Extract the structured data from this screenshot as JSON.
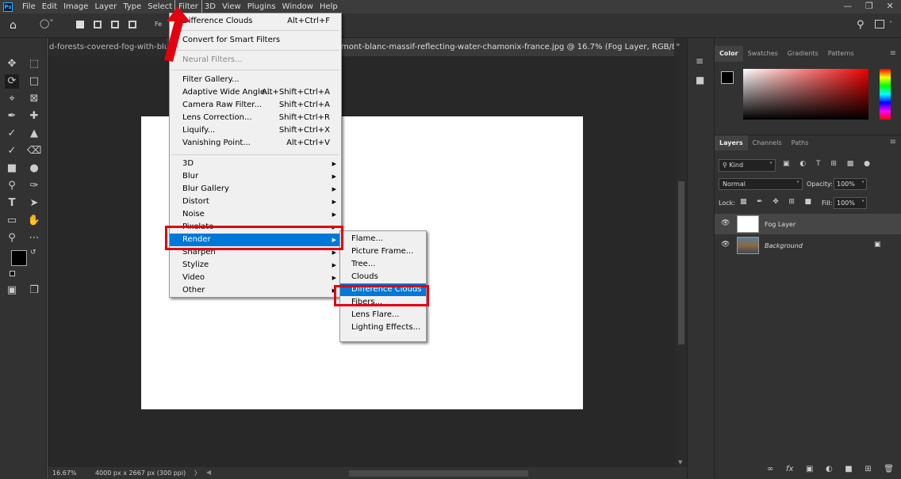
{
  "app": {
    "icon": "Ps"
  },
  "menubar": {
    "items": [
      "File",
      "Edit",
      "Image",
      "Layer",
      "Type",
      "Select",
      "Filter",
      "3D",
      "View",
      "Plugins",
      "Window",
      "Help"
    ],
    "active": "Filter"
  },
  "tabs": {
    "tab1": "d-forests-covered-fog-with-blurr",
    "tab2": "mont-blanc-massif-reflecting-water-chamonix-france.jpg @ 16.7% (Fog Layer, RGB/8#) *",
    "tab2_close": "×"
  },
  "options": {
    "partial_label": "Fe"
  },
  "filter_menu": {
    "last_filter": {
      "label": "Difference Clouds",
      "shortcut": "Alt+Ctrl+F"
    },
    "smart": "Convert for Smart Filters",
    "neural": "Neural Filters...",
    "group1": [
      {
        "label": "Filter Gallery...",
        "shortcut": ""
      },
      {
        "label": "Adaptive Wide Angle...",
        "shortcut": "Alt+Shift+Ctrl+A"
      },
      {
        "label": "Camera Raw Filter...",
        "shortcut": "Shift+Ctrl+A"
      },
      {
        "label": "Lens Correction...",
        "shortcut": "Shift+Ctrl+R"
      },
      {
        "label": "Liquify...",
        "shortcut": "Shift+Ctrl+X"
      },
      {
        "label": "Vanishing Point...",
        "shortcut": "Alt+Ctrl+V"
      }
    ],
    "group2": [
      "3D",
      "Blur",
      "Blur Gallery",
      "Distort",
      "Noise",
      "Pixelate",
      "Render",
      "Sharpen",
      "Stylize",
      "Video",
      "Other"
    ],
    "highlighted": "Render"
  },
  "render_submenu": {
    "items": [
      "Flame...",
      "Picture Frame...",
      "Tree...",
      "Clouds",
      "Difference Clouds",
      "Fibers...",
      "Lens Flare...",
      "Lighting Effects..."
    ],
    "highlighted": "Difference Clouds"
  },
  "statusbar": {
    "zoom": "16.67%",
    "doc_info": "4000 px x 2667 px (300 ppi)",
    "arrow": "〉"
  },
  "color_panel": {
    "tabs": [
      "Color",
      "Swatches",
      "Gradients",
      "Patterns"
    ],
    "active": "Color"
  },
  "layers_panel": {
    "tabs": [
      "Layers",
      "Channels",
      "Paths"
    ],
    "active": "Layers",
    "filter_kind": "Kind",
    "blend_mode": "Normal",
    "opacity_label": "Opacity:",
    "opacity": "100%",
    "lock_label": "Lock:",
    "fill_label": "Fill:",
    "fill": "100%",
    "layers": [
      {
        "name": "Fog Layer",
        "selected": true,
        "italic": false,
        "locked": false
      },
      {
        "name": "Background",
        "selected": false,
        "italic": true,
        "locked": true
      }
    ]
  },
  "colors": {
    "highlight": "#0078d7",
    "annotation_red": "#e3000f",
    "fg_color": "#000000",
    "bg_color": "#ffffff"
  }
}
